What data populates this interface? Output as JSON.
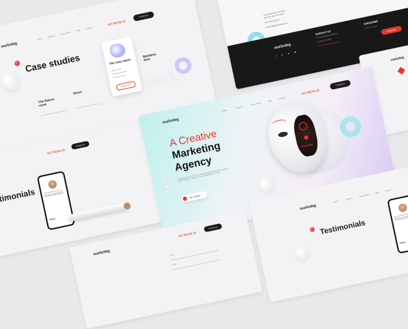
{
  "brand": {
    "logo_text": "marketing",
    "accent": "#e6382b",
    "dark": "#1b1b1b"
  },
  "nav": {
    "items": [
      "Home",
      "Services",
      "Case studies",
      "Blog",
      "Contact"
    ],
    "phone": "517 503 81 12",
    "cta": "Contact us"
  },
  "hero": {
    "title_line1": "A Creative",
    "title_line2": "Marketing",
    "title_line3": "Agency",
    "description": "Lorem ipsum dolor sit amet consectetur adipiscing elit sed do eiusmod tempor incididunt ut labore et dolore magna aliqua ut enim.",
    "button": "Our portfolio"
  },
  "case_studies": {
    "title": "Case studies",
    "cards": [
      "The Ratron room",
      "Szucs",
      "The very warm",
      "Bambina blue"
    ],
    "card_button": "Read more",
    "features": [
      "Social media",
      "Content production",
      "Campaign setup"
    ]
  },
  "contact": {
    "address_line1": "79 Leonard Street, Suite 606",
    "address_line2": "New York, New York 10013",
    "phone": "Tel: (555) 555 5555",
    "email": "Email: hello@marketing.com",
    "heading": "CONTACT US",
    "subscribe": "SUBSCRIBE",
    "subscribe_placeholder": "Enter your email",
    "subscribe_button": "Subscribe"
  },
  "testimonials": {
    "title_left": "timonials",
    "title_right": "Testimonials",
    "quote": "Jack and his team are a joy to work with. Very responsive and the results speak for themselves.",
    "author": "Melany",
    "author_role": "Founder"
  },
  "footer": {
    "field1_placeholder": "Name",
    "field2_placeholder": "Email"
  }
}
